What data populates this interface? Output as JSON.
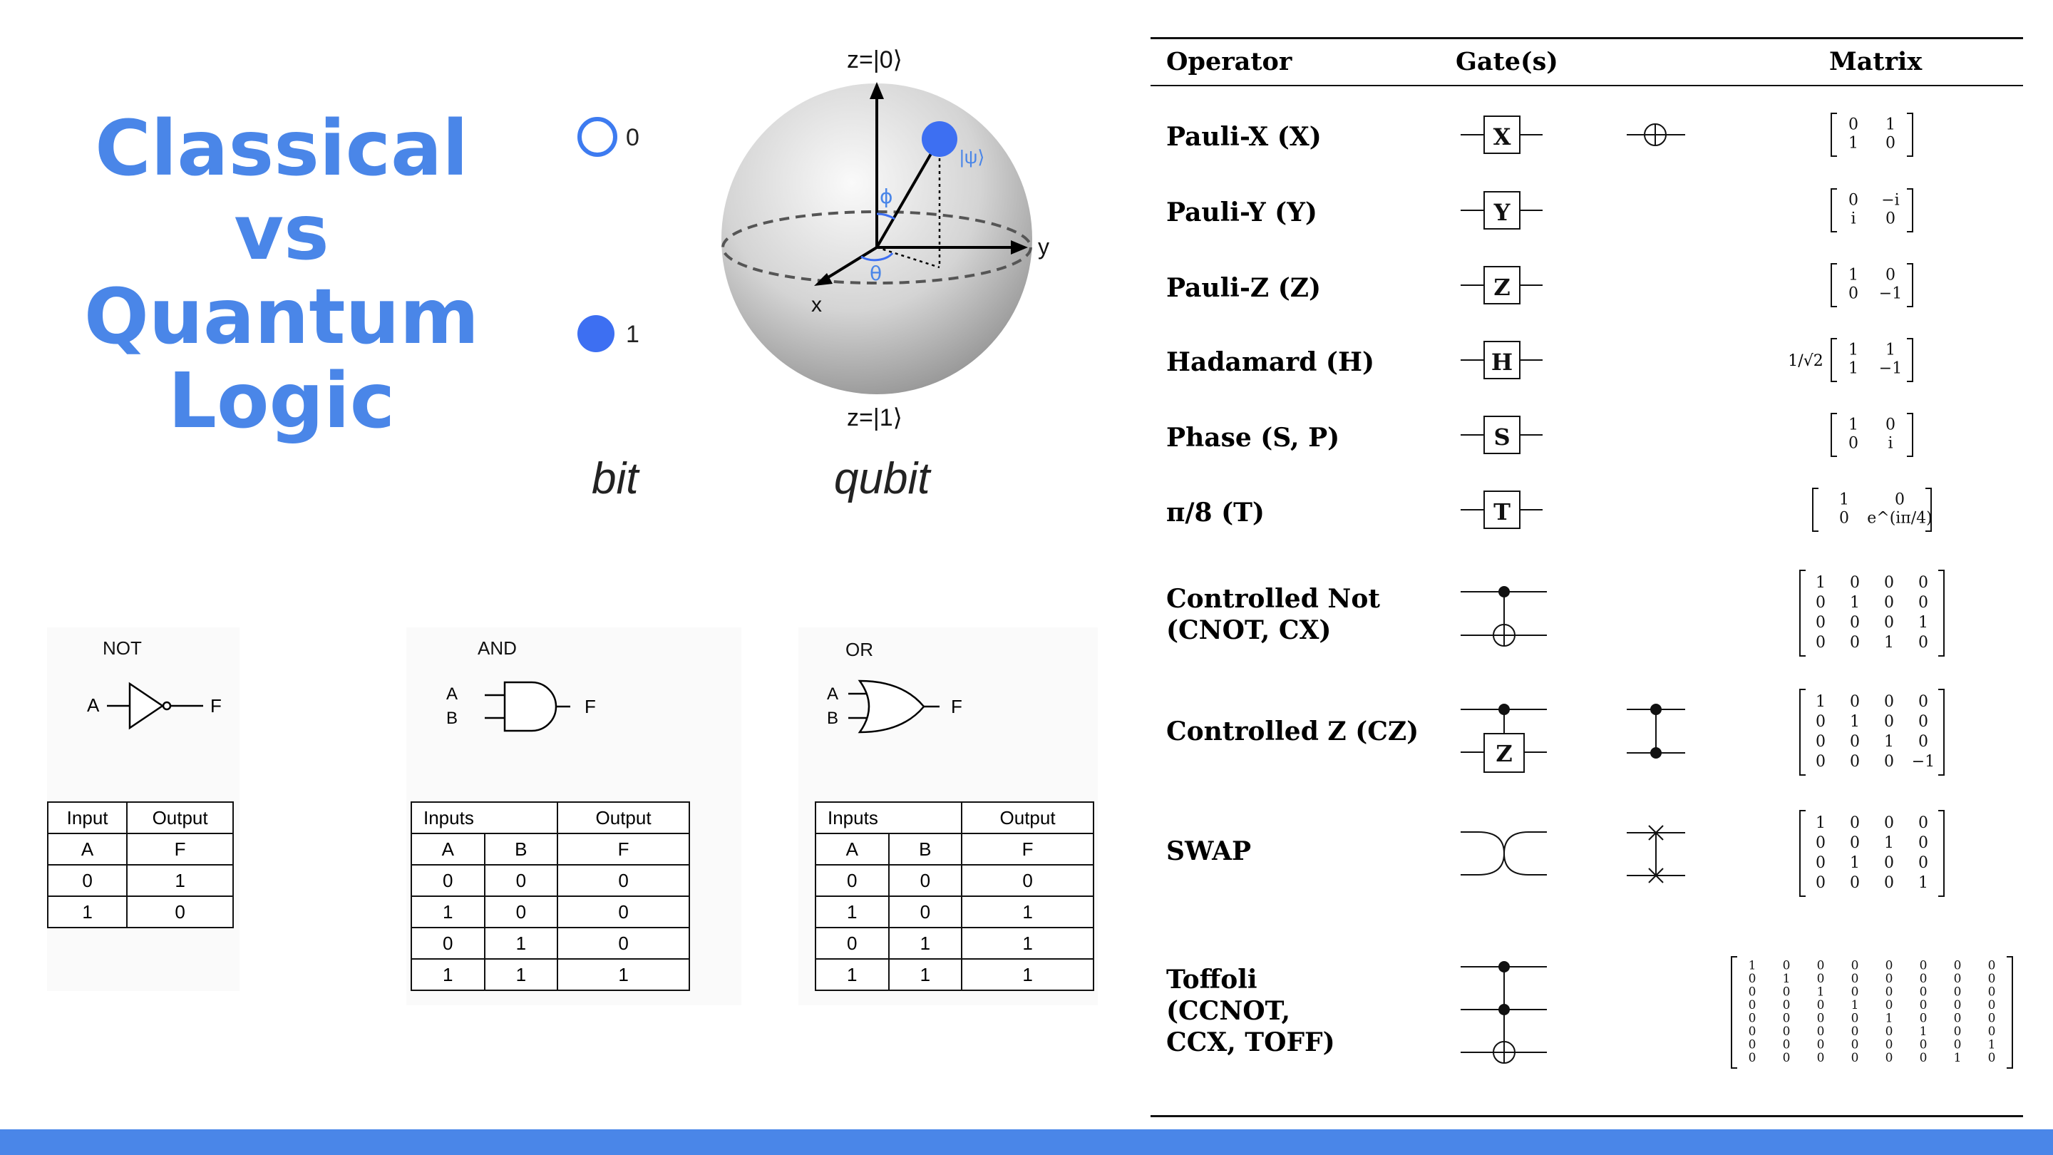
{
  "slide": {
    "title_lines": [
      "Classical",
      "vs",
      "Quantum",
      "Logic"
    ],
    "accent_color": "#4a86e8"
  },
  "bit": {
    "state0_label": "0",
    "state1_label": "1",
    "caption": "bit"
  },
  "qubit": {
    "caption": "qubit",
    "top_label": "z=|0⟩",
    "bottom_label": "z=|1⟩",
    "state_label": "|ψ⟩",
    "x_label": "x",
    "y_label": "y",
    "phi_label": "ϕ",
    "theta_label": "θ"
  },
  "classical_gates": [
    {
      "name": "NOT",
      "inputs": [
        "A"
      ],
      "output": "F",
      "table": {
        "group_headers": [
          "Input",
          "Output"
        ],
        "columns": [
          "A",
          "F"
        ],
        "rows": [
          [
            "0",
            "1"
          ],
          [
            "1",
            "0"
          ]
        ]
      }
    },
    {
      "name": "AND",
      "inputs": [
        "A",
        "B"
      ],
      "output": "F",
      "table": {
        "group_headers": [
          "Inputs",
          "Output"
        ],
        "columns": [
          "A",
          "B",
          "F"
        ],
        "rows": [
          [
            "0",
            "0",
            "0"
          ],
          [
            "1",
            "0",
            "0"
          ],
          [
            "0",
            "1",
            "0"
          ],
          [
            "1",
            "1",
            "1"
          ]
        ]
      }
    },
    {
      "name": "OR",
      "inputs": [
        "A",
        "B"
      ],
      "output": "F",
      "table": {
        "group_headers": [
          "Inputs",
          "Output"
        ],
        "columns": [
          "A",
          "B",
          "F"
        ],
        "rows": [
          [
            "0",
            "0",
            "0"
          ],
          [
            "1",
            "0",
            "1"
          ],
          [
            "0",
            "1",
            "1"
          ],
          [
            "1",
            "1",
            "1"
          ]
        ]
      }
    }
  ],
  "quantum_table": {
    "headers": {
      "operator": "Operator",
      "gates": "Gate(s)",
      "matrix": "Matrix"
    },
    "rows": [
      {
        "operator_lines": [
          "Pauli-X (X)"
        ],
        "gate_letter": "X",
        "matrix": [
          [
            "0",
            "1"
          ],
          [
            "1",
            "0"
          ]
        ]
      },
      {
        "operator_lines": [
          "Pauli-Y (Y)"
        ],
        "gate_letter": "Y",
        "matrix": [
          [
            "0",
            "−i"
          ],
          [
            "i",
            "0"
          ]
        ]
      },
      {
        "operator_lines": [
          "Pauli-Z (Z)"
        ],
        "gate_letter": "Z",
        "matrix": [
          [
            "1",
            "0"
          ],
          [
            "0",
            "−1"
          ]
        ]
      },
      {
        "operator_lines": [
          "Hadamard (H)"
        ],
        "gate_letter": "H",
        "matrix_prefix": "1/√2",
        "matrix": [
          [
            "1",
            "1"
          ],
          [
            "1",
            "−1"
          ]
        ]
      },
      {
        "operator_lines": [
          "Phase (S, P)"
        ],
        "gate_letter": "S",
        "matrix": [
          [
            "1",
            "0"
          ],
          [
            "0",
            "i"
          ]
        ]
      },
      {
        "operator_lines": [
          "π/8 (T)"
        ],
        "gate_letter": "T",
        "matrix": [
          [
            "1",
            "0"
          ],
          [
            "0",
            "e^{iπ/4}"
          ]
        ]
      },
      {
        "operator_lines": [
          "Controlled Not",
          "(CNOT, CX)"
        ],
        "matrix": [
          [
            "1",
            "0",
            "0",
            "0"
          ],
          [
            "0",
            "1",
            "0",
            "0"
          ],
          [
            "0",
            "0",
            "0",
            "1"
          ],
          [
            "0",
            "0",
            "1",
            "0"
          ]
        ]
      },
      {
        "operator_lines": [
          "Controlled Z (CZ)"
        ],
        "gate_letter": "Z",
        "matrix": [
          [
            "1",
            "0",
            "0",
            "0"
          ],
          [
            "0",
            "1",
            "0",
            "0"
          ],
          [
            "0",
            "0",
            "1",
            "0"
          ],
          [
            "0",
            "0",
            "0",
            "−1"
          ]
        ]
      },
      {
        "operator_lines": [
          "SWAP"
        ],
        "matrix": [
          [
            "1",
            "0",
            "0",
            "0"
          ],
          [
            "0",
            "0",
            "1",
            "0"
          ],
          [
            "0",
            "1",
            "0",
            "0"
          ],
          [
            "0",
            "0",
            "0",
            "1"
          ]
        ]
      },
      {
        "operator_lines": [
          "Toffoli",
          "(CCNOT,",
          "CCX, TOFF)"
        ],
        "matrix": [
          [
            "1",
            "0",
            "0",
            "0",
            "0",
            "0",
            "0",
            "0"
          ],
          [
            "0",
            "1",
            "0",
            "0",
            "0",
            "0",
            "0",
            "0"
          ],
          [
            "0",
            "0",
            "1",
            "0",
            "0",
            "0",
            "0",
            "0"
          ],
          [
            "0",
            "0",
            "0",
            "1",
            "0",
            "0",
            "0",
            "0"
          ],
          [
            "0",
            "0",
            "0",
            "0",
            "1",
            "0",
            "0",
            "0"
          ],
          [
            "0",
            "0",
            "0",
            "0",
            "0",
            "1",
            "0",
            "0"
          ],
          [
            "0",
            "0",
            "0",
            "0",
            "0",
            "0",
            "0",
            "1"
          ],
          [
            "0",
            "0",
            "0",
            "0",
            "0",
            "0",
            "1",
            "0"
          ]
        ]
      }
    ]
  }
}
